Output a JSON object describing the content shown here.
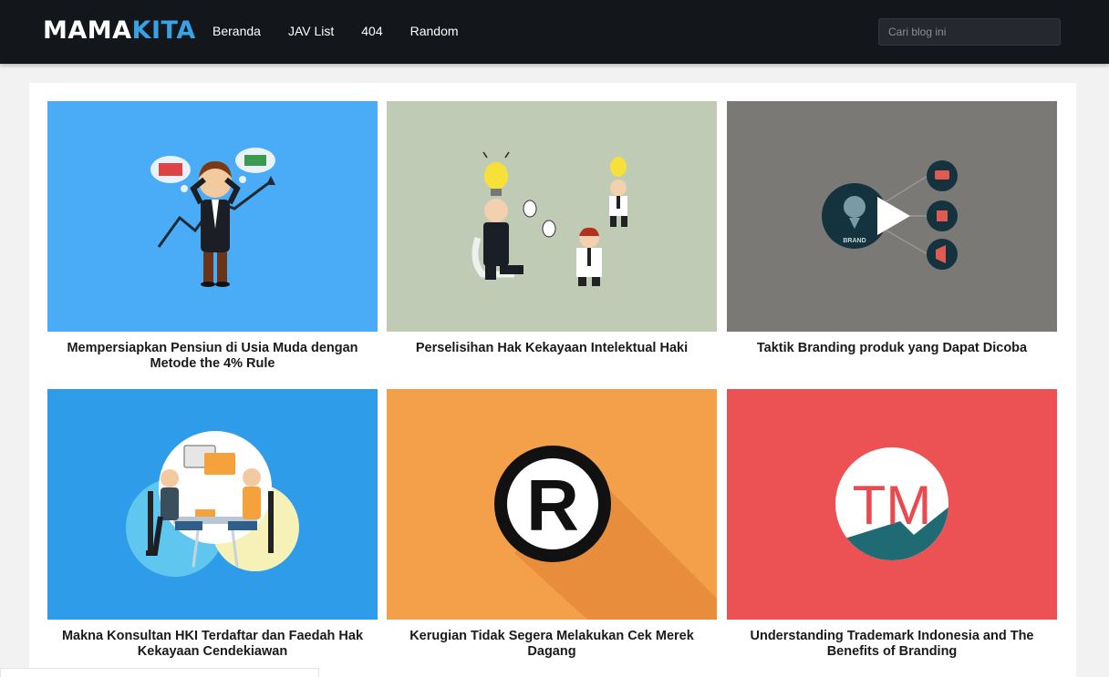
{
  "header": {
    "logo_part1": "MAMA",
    "logo_part2": "KITA",
    "nav": [
      "Beranda",
      "JAV List",
      "404",
      "Random"
    ],
    "search_placeholder": "Cari blog ini"
  },
  "posts": [
    {
      "title": "Mempersiapkan Pensiun di Usia Muda dengan Metode the 4% Rule",
      "thumb_color": "#4aabf6",
      "thumb_icon": "businessman-growth-illustration"
    },
    {
      "title": "Perselisihan Hak Kekayaan Intelektual Haki",
      "thumb_color": "#bfcbb4",
      "thumb_icon": "lightbulb-ideas-illustration"
    },
    {
      "title": "Taktik Branding produk yang Dapat Dicoba",
      "thumb_color": "#7b7975",
      "thumb_icon": "video-play-icon"
    },
    {
      "title": "Makna Konsultan HKI Terdaftar dan Faedah Hak Kekayaan Cendekiawan",
      "thumb_color": "#2e9ce8",
      "thumb_icon": "consultation-illustration"
    },
    {
      "title": "Kerugian Tidak Segera Melakukan Cek Merek Dagang",
      "thumb_color": "#f4a04b",
      "thumb_icon": "registered-mark-icon"
    },
    {
      "title": "Understanding Trademark Indonesia and The Benefits of Branding",
      "thumb_color": "#ec5154",
      "thumb_icon": "trademark-icon"
    }
  ],
  "thumb_texts": {
    "brand_badge": "BRAND",
    "registered_letter": "R",
    "trademark_letters": "TM"
  }
}
